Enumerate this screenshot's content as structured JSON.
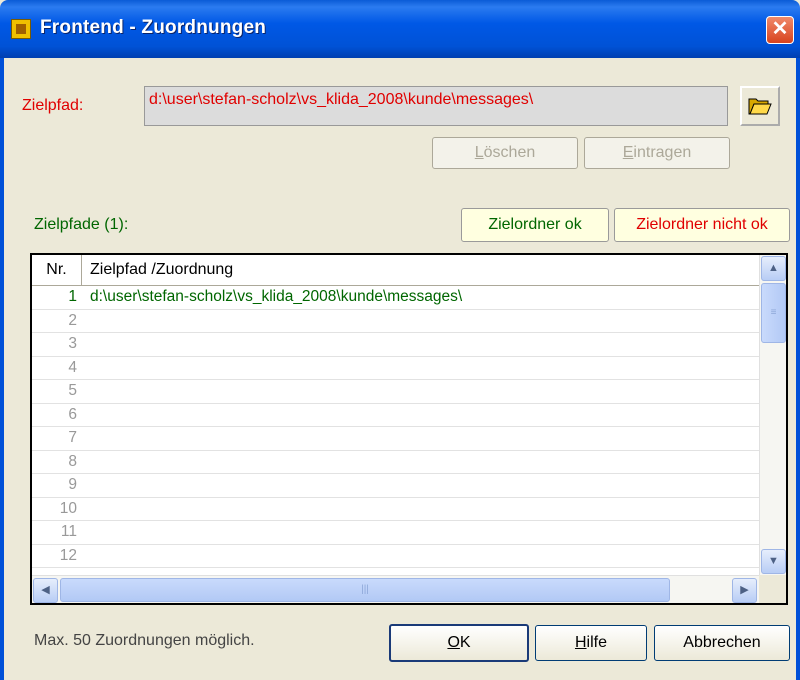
{
  "window": {
    "title": "Frontend - Zuordnungen",
    "close_symbol": "✕"
  },
  "target": {
    "label": "Zielpfad:",
    "value": "d:\\user\\stefan-scholz\\vs_klida_2008\\kunde\\messages\\",
    "browse_icon": "folder-open-icon"
  },
  "actions": {
    "delete_label": "Löschen",
    "delete_accel": "L",
    "delete_rest": "öschen",
    "add_label": "Eintragen",
    "add_accel": "E",
    "add_rest": "intragen"
  },
  "list": {
    "count_label": "Zielpfade (1):",
    "legend_ok": "Zielordner ok",
    "legend_bad": "Zielordner nicht ok",
    "columns": [
      "Nr.",
      "Zielpfad /Zuordnung"
    ],
    "rows": [
      {
        "nr": "1",
        "path": "d:\\user\\stefan-scholz\\vs_klida_2008\\kunde\\messages\\"
      },
      {
        "nr": "2",
        "path": ""
      },
      {
        "nr": "3",
        "path": ""
      },
      {
        "nr": "4",
        "path": ""
      },
      {
        "nr": "5",
        "path": ""
      },
      {
        "nr": "6",
        "path": ""
      },
      {
        "nr": "7",
        "path": ""
      },
      {
        "nr": "8",
        "path": ""
      },
      {
        "nr": "9",
        "path": ""
      },
      {
        "nr": "10",
        "path": ""
      },
      {
        "nr": "11",
        "path": ""
      },
      {
        "nr": "12",
        "path": ""
      }
    ]
  },
  "footer": {
    "hint": "Max. 50 Zuordnungen möglich.",
    "ok_accel": "O",
    "ok_rest": "K",
    "help_accel": "H",
    "help_rest": "ilfe",
    "cancel_label": "Abbrechen"
  },
  "colors": {
    "ok": "#006600",
    "bad": "#e00000",
    "titlebar": "#0058e6"
  }
}
